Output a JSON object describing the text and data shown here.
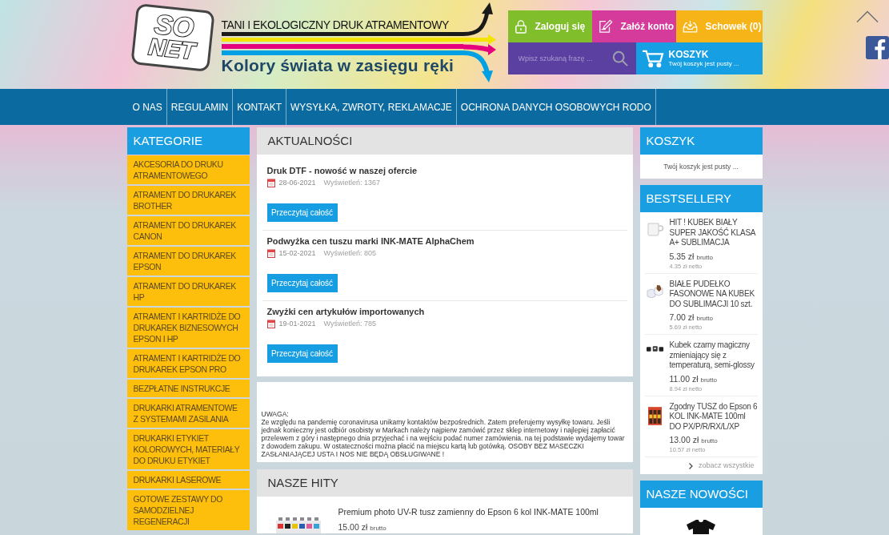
{
  "logo": {
    "lines": [
      "SO",
      "NET"
    ]
  },
  "banner": {
    "tagline": "TANI I EKOLOGICZNY DRUK ATRAMENTOWY",
    "slogan": "Kolory świata w zasięgu ręki"
  },
  "account_buttons": [
    {
      "kind": "login",
      "label": "Zaloguj się"
    },
    {
      "kind": "register",
      "label": "Załóż konto"
    },
    {
      "kind": "wishlist",
      "label": "Schowek (0)"
    }
  ],
  "search": {
    "placeholder": "Wpisz szukaną frazę ..."
  },
  "cart_button": {
    "title": "KOSZYK",
    "subtitle": "Twój koszyk jest pusty ..."
  },
  "nav": [
    "O NAS",
    "REGULAMIN",
    "KONTAKT",
    "WYSYŁKA, ZWROTY, REKLAMACJE",
    "OCHRONA DANYCH OSOBOWYCH RODO"
  ],
  "categories": {
    "title": "KATEGORIE",
    "items": [
      "AKCESORIA DO DRUKU ATRAMENTOWEGO",
      "ATRAMENT DO DRUKAREK BROTHER",
      "ATRAMENT DO DRUKAREK CANON",
      "ATRAMENT DO DRUKAREK EPSON",
      "ATRAMENT DO DRUKAREK HP",
      "ATRAMENT I KARTRIDŻE DO DRUKAREK BIZNESOWYCH EPSON I HP",
      "ATRAMENT I KARTRIDŻE DO DRUKAREK EPSON PRO",
      "BEZPŁATNE INSTRUKCJE",
      "DRUKARKI ATRAMENTOWE Z SYSTEMAMI ZASILANIA",
      "DRUKARKI ETYKIET KOLOROWYCH, MATERIAŁY DO DRUKU ETYKIET",
      "DRUKARKI LASEROWE",
      "GOTOWE ZESTAWY DO SAMODZIELNEJ REGENERACJI"
    ]
  },
  "news": {
    "title": "AKTUALNOŚCI",
    "items": [
      {
        "title": "Druk DTF - nowość w naszej ofercie",
        "date": "28-06-2021",
        "views": "Wyświetleń: 1367",
        "button": "Przeczytaj całość"
      },
      {
        "title": "Podwyżka cen tuszu marki INK-MATE AlphaChem",
        "date": "15-02-2021",
        "views": "Wyświetleń: 805",
        "button": "Przeczytaj całość"
      },
      {
        "title": "Zwyżki cen artykułów importowanych",
        "date": "19-01-2021",
        "views": "Wyświetleń: 785",
        "button": "Przeczytaj całość"
      }
    ]
  },
  "notice": {
    "heading": "UWAGA:",
    "text": "Ze względu na pandemię coronavirusa unikamy kontaktów bezpośrednich. Zatem preferujemy wysyłkę towaru. Jeśli jednak konieczny jest odbiór osobisty w Markach należy najpierw zamówić przez sklep internetowy i najlepiej zapłacić przelewem z góry i następnego dnia przyjechać i na wejściu podać numer zamówienia. na tej podstawie wydajemy towar z dowodem zakupu. W ostateczności można płacić na miejscu kartą lub gotówką. OSOBY BEZ MASECZKI ZASŁANIAJĄCEJ USTA I NOS NIE BĘDĄ OBSŁUGIWANE !"
  },
  "hits": {
    "title": "NASZE HITY",
    "products": [
      {
        "kind": "bottle-set",
        "name": "Premium photo UV-R tusz zamienny do Epson 6 kol INK-MATE 100ml",
        "price": "15.00 zł",
        "price_label": "brutto"
      }
    ]
  },
  "cart": {
    "title": "KOSZYK",
    "text": "Twój koszyk jest pusty ..."
  },
  "bestsellers": {
    "title": "BESTSELLERY",
    "products": [
      {
        "kind": "mug",
        "name": "HIT ! KUBEK BIAŁY SUPER JAKOŚĆ KLASA A+ SUBLIMACJA",
        "price": "5.35 zł",
        "price_label": "brutto",
        "net_price": "4.35 zł",
        "net_label": "netto"
      },
      {
        "kind": "boxes",
        "name": "BIAŁE PUDEŁKO FASONOWE NA KUBEK DO SUBLIMACJI 10 szt.",
        "price": "7.00 zł",
        "price_label": "brutto",
        "net_price": "5.69 zł",
        "net_label": "netto"
      },
      {
        "kind": "mug-set",
        "name": "Kubek czarny magiczny zmieniający się z temperaturą, semi-glossy",
        "price": "11.00 zł",
        "price_label": "brutto",
        "net_price": "8.94 zł",
        "net_label": "netto"
      },
      {
        "kind": "ink-bottles",
        "name": "Zgodny TUSZ do Epson 6 KOL INK-MATE 100ml DO PX/P/R/RX/L/XP",
        "price": "13.00 zł",
        "price_label": "brutto",
        "net_price": "10.57 zł",
        "net_label": "netto"
      }
    ],
    "more_link": "zobacz wszystkie"
  },
  "new_products": {
    "title": "NASZE NOWOŚCI",
    "products": [
      {
        "kind": "t-shirt"
      }
    ]
  }
}
